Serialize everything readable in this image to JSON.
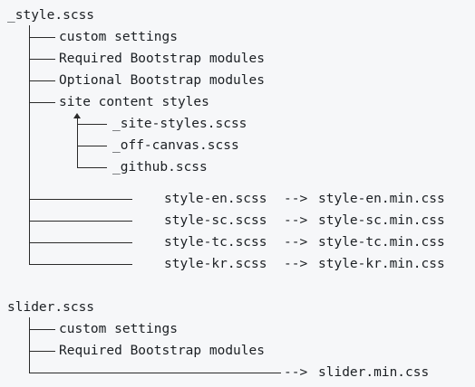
{
  "tree1": {
    "root": "_style.scss",
    "children": [
      "custom settings",
      "Required Bootstrap modules",
      "Optional Bootstrap modules",
      "site content styles"
    ],
    "sub_children": [
      "_site-styles.scss",
      "_off-canvas.scss",
      "_github.scss"
    ],
    "outputs": [
      {
        "src": "style-en.scss",
        "arrow": "-->",
        "dst": "style-en.min.css"
      },
      {
        "src": "style-sc.scss",
        "arrow": "-->",
        "dst": "style-sc.min.css"
      },
      {
        "src": "style-tc.scss",
        "arrow": "-->",
        "dst": "style-tc.min.css"
      },
      {
        "src": "style-kr.scss",
        "arrow": "-->",
        "dst": "style-kr.min.css"
      }
    ]
  },
  "tree2": {
    "root": "slider.scss",
    "children": [
      "custom settings",
      "Required Bootstrap modules"
    ],
    "output": {
      "arrow": "-->",
      "dst": "slider.min.css"
    }
  }
}
